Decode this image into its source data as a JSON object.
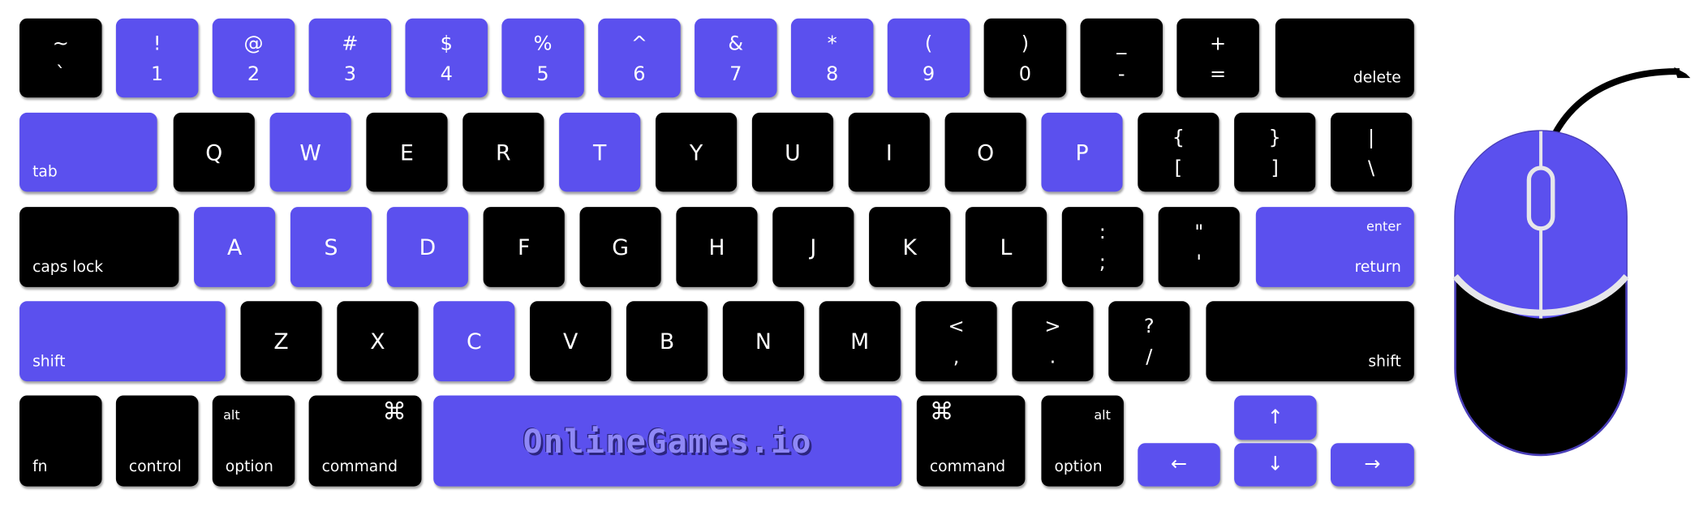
{
  "colors": {
    "highlight": "#5b50ee",
    "key": "#000000",
    "mouse_wheel": "#e6e6ea"
  },
  "keyboard": {
    "rows": [
      [
        {
          "top": "~",
          "bottom": "`",
          "hl": false
        },
        {
          "top": "!",
          "bottom": "1",
          "hl": true
        },
        {
          "top": "@",
          "bottom": "2",
          "hl": true
        },
        {
          "top": "#",
          "bottom": "3",
          "hl": true
        },
        {
          "top": "$",
          "bottom": "4",
          "hl": true
        },
        {
          "top": "%",
          "bottom": "5",
          "hl": true
        },
        {
          "top": "^",
          "bottom": "6",
          "hl": true
        },
        {
          "top": "&",
          "bottom": "7",
          "hl": true
        },
        {
          "top": "*",
          "bottom": "8",
          "hl": true
        },
        {
          "top": "(",
          "bottom": "9",
          "hl": true
        },
        {
          "top": ")",
          "bottom": "0",
          "hl": false
        },
        {
          "top": "_",
          "bottom": "-",
          "hl": false
        },
        {
          "top": "+",
          "bottom": "=",
          "hl": false
        },
        {
          "label": "delete",
          "hl": false
        }
      ],
      [
        {
          "label": "tab",
          "hl": true
        },
        {
          "top": "Q",
          "hl": false
        },
        {
          "top": "W",
          "hl": true
        },
        {
          "top": "E",
          "hl": false
        },
        {
          "top": "R",
          "hl": false
        },
        {
          "top": "T",
          "hl": true
        },
        {
          "top": "Y",
          "hl": false
        },
        {
          "top": "U",
          "hl": false
        },
        {
          "top": "I",
          "hl": false
        },
        {
          "top": "O",
          "hl": false
        },
        {
          "top": "P",
          "hl": true
        },
        {
          "top": "{",
          "bottom": "[",
          "hl": false
        },
        {
          "top": "}",
          "bottom": "]",
          "hl": false
        },
        {
          "top": "|",
          "bottom": "\\",
          "hl": false
        }
      ],
      [
        {
          "label": "caps lock",
          "hl": false
        },
        {
          "top": "A",
          "hl": true
        },
        {
          "top": "S",
          "hl": true
        },
        {
          "top": "D",
          "hl": true
        },
        {
          "top": "F",
          "hl": false
        },
        {
          "top": "G",
          "hl": false
        },
        {
          "top": "H",
          "hl": false
        },
        {
          "top": "J",
          "hl": false
        },
        {
          "top": "K",
          "hl": false
        },
        {
          "top": "L",
          "hl": false
        },
        {
          "top": ":",
          "bottom": ";",
          "hl": false
        },
        {
          "top": "\"",
          "bottom": "'",
          "hl": false
        },
        {
          "top": "enter",
          "label": "return",
          "hl": true
        }
      ],
      [
        {
          "label": "shift",
          "hl": true
        },
        {
          "top": "Z",
          "hl": false
        },
        {
          "top": "X",
          "hl": false
        },
        {
          "top": "C",
          "hl": true
        },
        {
          "top": "V",
          "hl": false
        },
        {
          "top": "B",
          "hl": false
        },
        {
          "top": "N",
          "hl": false
        },
        {
          "top": "M",
          "hl": false
        },
        {
          "top": "<",
          "bottom": ",",
          "hl": false
        },
        {
          "top": ">",
          "bottom": ".",
          "hl": false
        },
        {
          "top": "?",
          "bottom": "/",
          "hl": false
        },
        {
          "label": "shift",
          "hl": false
        }
      ],
      [
        {
          "label": "fn",
          "hl": false
        },
        {
          "label": "control",
          "hl": false
        },
        {
          "top": "alt",
          "label": "option",
          "hl": false
        },
        {
          "top": "⌘",
          "label": "command",
          "hl": false
        },
        {
          "logo": "OnlineGames.io",
          "hl": true
        },
        {
          "top": "⌘",
          "label": "command",
          "hl": false
        },
        {
          "top": "alt",
          "label": "option",
          "hl": false
        },
        {
          "top": "←",
          "hl": true
        },
        {
          "top": "↑",
          "hl": true
        },
        {
          "top": "↓",
          "hl": true
        },
        {
          "top": "→",
          "hl": true
        }
      ]
    ]
  },
  "mouse": {
    "icon": "mouse-icon",
    "left_button_highlighted": true,
    "right_button_highlighted": true
  }
}
